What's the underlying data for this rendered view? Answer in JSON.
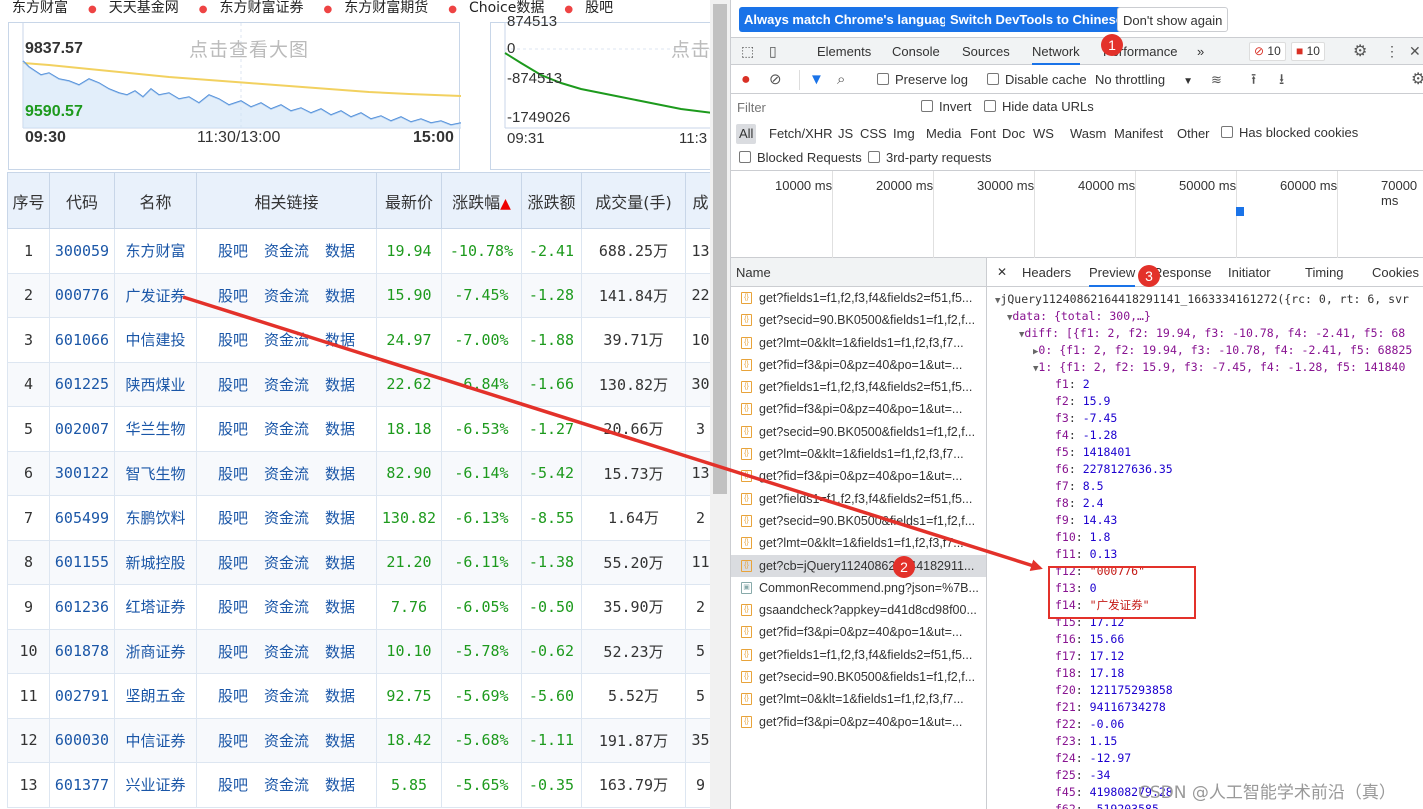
{
  "topnav": [
    "东方财富",
    "天天基金网",
    "东方财富证券",
    "东方财富期货",
    "Choice数据",
    "股吧"
  ],
  "chart1": {
    "top_value": "9837.57",
    "bottom_value": "9590.57",
    "times": [
      "09:30",
      "11:30/13:00",
      "15:00"
    ],
    "watermark": "点击查看大图"
  },
  "chart2": {
    "values": [
      "874513",
      "0",
      "-874513",
      "-1749026"
    ],
    "times": [
      "09:31",
      "11:3"
    ],
    "watermark": "点击"
  },
  "stock_table": {
    "headers": [
      "序号",
      "代码",
      "名称",
      "相关链接",
      "最新价",
      "涨跌幅",
      "涨跌额",
      "成交量(手)",
      "成"
    ],
    "link_labels": [
      "股吧",
      "资金流",
      "数据"
    ],
    "rows": [
      {
        "idx": "1",
        "code": "300059",
        "name": "东方财富",
        "price": "19.94",
        "pct": "-10.78%",
        "chg": "-2.41",
        "vol": "688.25万",
        "extra": "13"
      },
      {
        "idx": "2",
        "code": "000776",
        "name": "广发证券",
        "price": "15.90",
        "pct": "-7.45%",
        "chg": "-1.28",
        "vol": "141.84万",
        "extra": "22"
      },
      {
        "idx": "3",
        "code": "601066",
        "name": "中信建投",
        "price": "24.97",
        "pct": "-7.00%",
        "chg": "-1.88",
        "vol": "39.71万",
        "extra": "10"
      },
      {
        "idx": "4",
        "code": "601225",
        "name": "陕西煤业",
        "price": "22.62",
        "pct": "-6.84%",
        "chg": "-1.66",
        "vol": "130.82万",
        "extra": "30"
      },
      {
        "idx": "5",
        "code": "002007",
        "name": "华兰生物",
        "price": "18.18",
        "pct": "-6.53%",
        "chg": "-1.27",
        "vol": "20.66万",
        "extra": "3"
      },
      {
        "idx": "6",
        "code": "300122",
        "name": "智飞生物",
        "price": "82.90",
        "pct": "-6.14%",
        "chg": "-5.42",
        "vol": "15.73万",
        "extra": "13"
      },
      {
        "idx": "7",
        "code": "605499",
        "name": "东鹏饮料",
        "price": "130.82",
        "pct": "-6.13%",
        "chg": "-8.55",
        "vol": "1.64万",
        "extra": "2"
      },
      {
        "idx": "8",
        "code": "601155",
        "name": "新城控股",
        "price": "21.20",
        "pct": "-6.11%",
        "chg": "-1.38",
        "vol": "55.20万",
        "extra": "11"
      },
      {
        "idx": "9",
        "code": "601236",
        "name": "红塔证券",
        "price": "7.76",
        "pct": "-6.05%",
        "chg": "-0.50",
        "vol": "35.90万",
        "extra": "2"
      },
      {
        "idx": "10",
        "code": "601878",
        "name": "浙商证券",
        "price": "10.10",
        "pct": "-5.78%",
        "chg": "-0.62",
        "vol": "52.23万",
        "extra": "5"
      },
      {
        "idx": "11",
        "code": "002791",
        "name": "坚朗五金",
        "price": "92.75",
        "pct": "-5.69%",
        "chg": "-5.60",
        "vol": "5.52万",
        "extra": "5"
      },
      {
        "idx": "12",
        "code": "600030",
        "name": "中信证券",
        "price": "18.42",
        "pct": "-5.68%",
        "chg": "-1.11",
        "vol": "191.87万",
        "extra": "35"
      },
      {
        "idx": "13",
        "code": "601377",
        "name": "兴业证券",
        "price": "5.85",
        "pct": "-5.65%",
        "chg": "-0.35",
        "vol": "163.79万",
        "extra": "9"
      }
    ]
  },
  "devtools": {
    "infobar": {
      "btn_match": "Always match Chrome's language",
      "btn_chinese": "Switch DevTools to Chinese",
      "btn_dont_show": "Don't show again"
    },
    "tabs": [
      "Elements",
      "Console",
      "Sources",
      "Network",
      "Performance"
    ],
    "more_tabs": "»",
    "warn_count": "10",
    "error_count": "10",
    "toolbar": {
      "preserve_log": "Preserve log",
      "disable_cache": "Disable cache",
      "throttling": "No throttling"
    },
    "filter": {
      "placeholder": "Filter",
      "invert": "Invert",
      "hide_data_urls": "Hide data URLs"
    },
    "types": [
      "All",
      "Fetch/XHR",
      "JS",
      "CSS",
      "Img",
      "Media",
      "Font",
      "Doc",
      "WS",
      "Wasm",
      "Manifest",
      "Other"
    ],
    "has_blocked_cookies": "Has blocked cookies",
    "blocked_requests": "Blocked Requests",
    "third_party": "3rd-party requests",
    "timeline_labels": [
      "10000 ms",
      "20000 ms",
      "30000 ms",
      "40000 ms",
      "50000 ms",
      "60000 ms",
      "70000 ms"
    ],
    "name_header": "Name",
    "requests": [
      "get?fields1=f1,f2,f3,f4&fields2=f51,f5...",
      "get?secid=90.BK0500&fields1=f1,f2,f...",
      "get?lmt=0&klt=1&fields1=f1,f2,f3,f7...",
      "get?fid=f3&pi=0&pz=40&po=1&ut=...",
      "get?fields1=f1,f2,f3,f4&fields2=f51,f5...",
      "get?fid=f3&pi=0&pz=40&po=1&ut=...",
      "get?secid=90.BK0500&fields1=f1,f2,f...",
      "get?lmt=0&klt=1&fields1=f1,f2,f3,f7...",
      "get?fid=f3&pi=0&pz=40&po=1&ut=...",
      "get?fields1=f1,f2,f3,f4&fields2=f51,f5...",
      "get?secid=90.BK0500&fields1=f1,f2,f...",
      "get?lmt=0&klt=1&fields1=f1,f2,f3,f7...",
      "get?cb=jQuery112408621644182911...",
      "CommonRecommend.png?json=%7B...",
      "gsaandcheck?appkey=d41d8cd98f00...",
      "get?fid=f3&pi=0&pz=40&po=1&ut=...",
      "get?fields1=f1,f2,f3,f4&fields2=f51,f5...",
      "get?secid=90.BK0500&fields1=f1,f2,f...",
      "get?lmt=0&klt=1&fields1=f1,f2,f3,f7...",
      "get?fid=f3&pi=0&pz=40&po=1&ut=..."
    ],
    "preview_tabs": [
      "Headers",
      "Preview",
      "Response",
      "Initiator",
      "Timing",
      "Cookies"
    ],
    "preview": {
      "root": "jQuery11240862164418291141_1663334161272({rc: 0, rt: 6, svr",
      "data": "data: {total: 300,…}",
      "diff": "diff: [{f1: 2, f2: 19.94, f3: -10.78, f4: -2.41, f5: 68",
      "item0": "0: {f1: 2, f2: 19.94, f3: -10.78, f4: -2.41, f5: 68825",
      "item1": "1: {f1: 2, f2: 15.9, f3: -7.45, f4: -1.28, f5: 141840",
      "fields": [
        {
          "k": "f1",
          "v": "2",
          "t": "n"
        },
        {
          "k": "f2",
          "v": "15.9",
          "t": "n"
        },
        {
          "k": "f3",
          "v": "-7.45",
          "t": "n"
        },
        {
          "k": "f4",
          "v": "-1.28",
          "t": "n"
        },
        {
          "k": "f5",
          "v": "1418401",
          "t": "n"
        },
        {
          "k": "f6",
          "v": "2278127636.35",
          "t": "n"
        },
        {
          "k": "f7",
          "v": "8.5",
          "t": "n"
        },
        {
          "k": "f8",
          "v": "2.4",
          "t": "n"
        },
        {
          "k": "f9",
          "v": "14.43",
          "t": "n"
        },
        {
          "k": "f10",
          "v": "1.8",
          "t": "n"
        },
        {
          "k": "f11",
          "v": "0.13",
          "t": "n"
        },
        {
          "k": "f12",
          "v": "\"000776\"",
          "t": "s"
        },
        {
          "k": "f13",
          "v": "0",
          "t": "n"
        },
        {
          "k": "f14",
          "v": "\"广发证券\"",
          "t": "s"
        },
        {
          "k": "f15",
          "v": "17.12",
          "t": "n"
        },
        {
          "k": "f16",
          "v": "15.66",
          "t": "n"
        },
        {
          "k": "f17",
          "v": "17.12",
          "t": "n"
        },
        {
          "k": "f18",
          "v": "17.18",
          "t": "n"
        },
        {
          "k": "f20",
          "v": "121175293858",
          "t": "n"
        },
        {
          "k": "f21",
          "v": "94116734278",
          "t": "n"
        },
        {
          "k": "f22",
          "v": "-0.06",
          "t": "n"
        },
        {
          "k": "f23",
          "v": "1.15",
          "t": "n"
        },
        {
          "k": "f24",
          "v": "-12.97",
          "t": "n"
        },
        {
          "k": "f25",
          "v": "-34",
          "t": "n"
        },
        {
          "k": "f45",
          "v": "419808279.28",
          "t": "n"
        },
        {
          "k": "f62",
          "v": "-519203585",
          "t": "n"
        }
      ]
    }
  },
  "markers": [
    "1",
    "2",
    "3"
  ],
  "watermark_text": "CSDN @人工智能学术前沿（真）",
  "colors": {
    "accent": "#1a73e8",
    "marker": "#e3312a",
    "down": "#1d9a1d"
  }
}
